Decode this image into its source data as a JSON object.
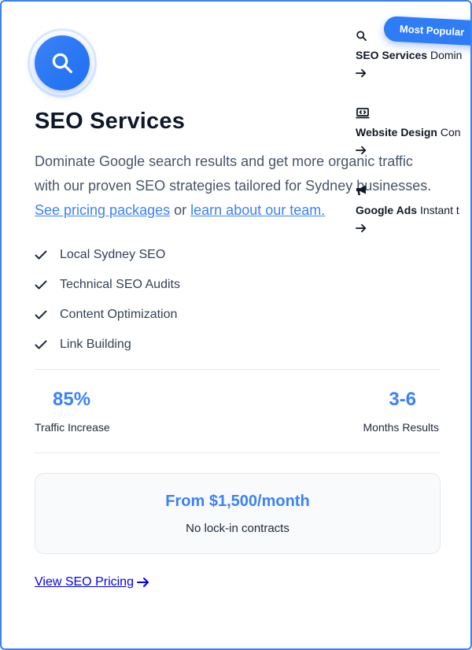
{
  "card": {
    "title": "SEO Services",
    "icon": "search-icon",
    "description_text": "Dominate Google search results and get more organic traffic with our proven SEO strategies tailored for Sydney businesses.",
    "link_pricing_label": "See pricing packages",
    "connector": "or",
    "link_team_label": "learn about our team.",
    "features": [
      "Local Sydney SEO",
      "Technical SEO Audits",
      "Content Optimization",
      "Link Building"
    ],
    "stats": [
      {
        "value": "85%",
        "label": "Traffic Increase"
      },
      {
        "value": "3-6",
        "label": "Months Results"
      }
    ],
    "price": {
      "main": "From $1,500/month",
      "sub": "No lock-in contracts"
    },
    "cta_label": "View SEO Pricing"
  },
  "badge": {
    "label": "Most Popular"
  },
  "side_cards": [
    {
      "icon": "search-icon",
      "name": "SEO Services",
      "text": "Domin"
    },
    {
      "icon": "code-laptop-icon",
      "name": "Website Design",
      "text": "Con"
    },
    {
      "icon": "megaphone-icon",
      "name": "Google Ads",
      "text": "Instant t"
    }
  ],
  "colors": {
    "accent": "#3b82f6",
    "heading": "#0f172a",
    "body": "#475569",
    "border": "#e5e7eb"
  }
}
